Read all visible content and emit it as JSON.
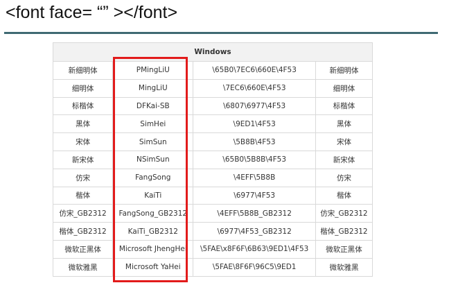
{
  "slide": {
    "title": "<font face= “” ></font>"
  },
  "table": {
    "header": "Windows",
    "rows": [
      {
        "cn": "新细明体",
        "en": "PMingLiU",
        "unicode": "\\65B0\\7EC6\\660E\\4F53",
        "cn2": "新细明体"
      },
      {
        "cn": "细明体",
        "en": "MingLiU",
        "unicode": "\\7EC6\\660E\\4F53",
        "cn2": "细明体"
      },
      {
        "cn": "标楷体",
        "en": "DFKai-SB",
        "unicode": "\\6807\\6977\\4F53",
        "cn2": "标楷体"
      },
      {
        "cn": "黑体",
        "en": "SimHei",
        "unicode": "\\9ED1\\4F53",
        "cn2": "黑体"
      },
      {
        "cn": "宋体",
        "en": "SimSun",
        "unicode": "\\5B8B\\4F53",
        "cn2": "宋体"
      },
      {
        "cn": "新宋体",
        "en": "NSimSun",
        "unicode": "\\65B0\\5B8B\\4F53",
        "cn2": "新宋体"
      },
      {
        "cn": "仿宋",
        "en": "FangSong",
        "unicode": "\\4EFF\\5B8B",
        "cn2": "仿宋"
      },
      {
        "cn": "楷体",
        "en": "KaiTi",
        "unicode": "\\6977\\4F53",
        "cn2": "楷体"
      },
      {
        "cn": "仿宋_GB2312",
        "en": "FangSong_GB2312",
        "unicode": "\\4EFF\\5B8B_GB2312",
        "cn2": "仿宋_GB2312"
      },
      {
        "cn": "楷体_GB2312",
        "en": "KaiTi_GB2312",
        "unicode": "\\6977\\4F53_GB2312",
        "cn2": "楷体_GB2312"
      },
      {
        "cn": "微软正黑体",
        "en": "Microsoft JhengHei",
        "unicode": "\\5FAE\\x8F6F\\6B63\\9ED1\\4F53",
        "cn2": "微软正黑体"
      },
      {
        "cn": "微软雅黑",
        "en": "Microsoft YaHei",
        "unicode": "\\5FAE\\8F6F\\96C5\\9ED1",
        "cn2": "微软雅黑"
      }
    ]
  },
  "colors": {
    "title_rule": "#3f6a73",
    "highlight": "#e21b1b",
    "header_bg": "#f2f2f2",
    "cell_border": "#d9d9d9"
  }
}
